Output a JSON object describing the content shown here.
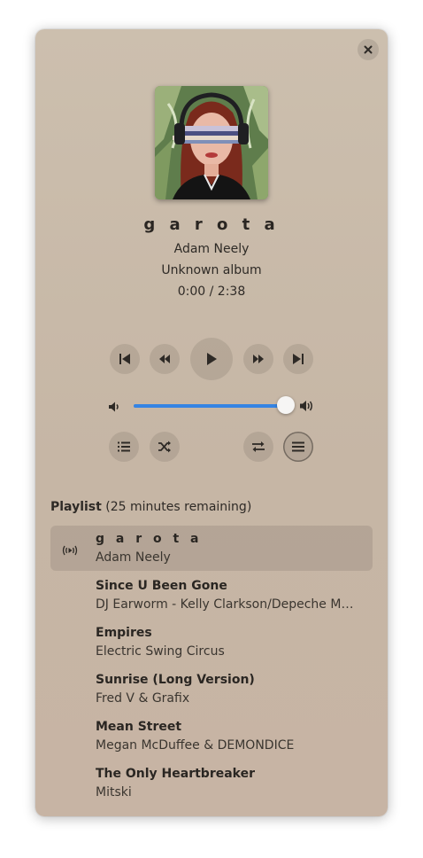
{
  "player": {
    "title": "g a r o t a",
    "artist": "Adam Neely",
    "album": "Unknown album",
    "time": "0:00 / 2:38",
    "volume_fraction": 0.99,
    "accent_color": "#3584e4"
  },
  "controls": {
    "icons": [
      "skip-backward-icon",
      "seek-backward-icon",
      "play-icon",
      "seek-forward-icon",
      "skip-forward-icon",
      "volume-low-icon",
      "volume-high-icon",
      "playlist-icon",
      "shuffle-icon",
      "repeat-icon",
      "menu-icon",
      "close-icon"
    ]
  },
  "playlist": {
    "heading_bold": "Playlist",
    "heading_rest": " (25 minutes remaining)",
    "items": [
      {
        "title": "g a r o t a",
        "artist": "Adam Neely",
        "active": true
      },
      {
        "title": "Since U Been Gone",
        "artist": "DJ Earworm - Kelly Clarkson/Depeche Mode/Baja Men"
      },
      {
        "title": "Empires",
        "artist": "Electric Swing Circus"
      },
      {
        "title": "Sunrise (Long Version)",
        "artist": "Fred V & Grafix"
      },
      {
        "title": "Mean Street",
        "artist": "Megan McDuffee & DEMONDICE"
      },
      {
        "title": "The Only Heartbreaker",
        "artist": "Mitski"
      }
    ]
  }
}
